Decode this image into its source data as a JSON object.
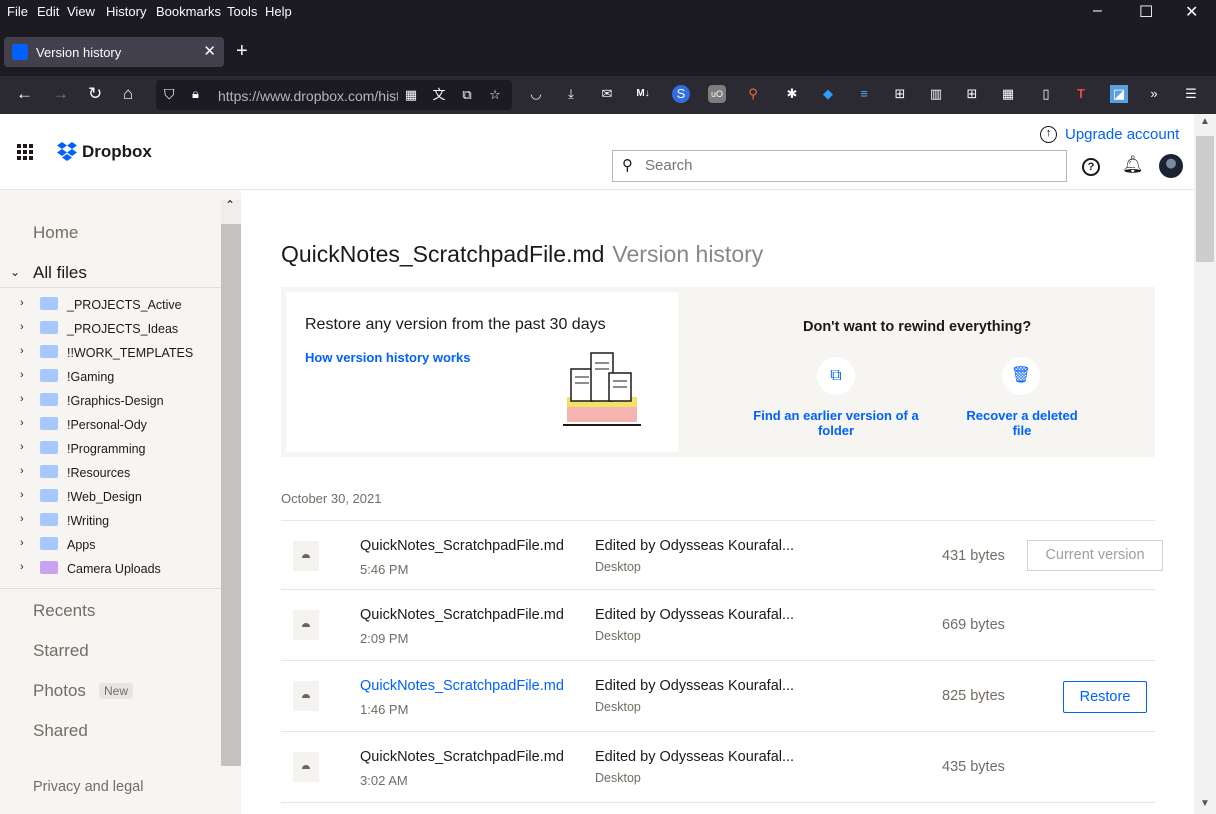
{
  "browser": {
    "menu": [
      "File",
      "Edit",
      "View",
      "History",
      "Bookmarks",
      "Tools",
      "Help"
    ],
    "tab_title": "Version history",
    "url": "https://www.dropbox.com/history"
  },
  "header": {
    "logo": "Dropbox",
    "upgrade": "Upgrade account",
    "search_placeholder": "Search"
  },
  "sidebar": {
    "home": "Home",
    "all_files": "All files",
    "folders": [
      "_PROJECTS_Active",
      "_PROJECTS_Ideas",
      "!!WORK_TEMPLATES",
      "!Gaming",
      "!Graphics-Design",
      "!Personal-Ody",
      "!Programming",
      "!Resources",
      "!Web_Design",
      "!Writing",
      "Apps",
      "Camera Uploads"
    ],
    "recents": "Recents",
    "starred": "Starred",
    "photos": "Photos",
    "photos_badge": "New",
    "shared": "Shared",
    "privacy": "Privacy and legal"
  },
  "main": {
    "filename": "QuickNotes_ScratchpadFile.md",
    "subtitle": "Version history",
    "banner": {
      "heading": "Restore any version from the past 30 days",
      "link": "How version history works",
      "right_heading": "Don't want to rewind everything?",
      "action1": "Find an earlier version of a folder",
      "action2": "Recover a deleted file"
    },
    "date": "October 30, 2021",
    "versions": [
      {
        "name": "QuickNotes_ScratchpadFile.md",
        "time": "5:46 PM",
        "edited": "Edited by Odysseas Kourafal...",
        "device": "Desktop",
        "size": "431 bytes",
        "action": "Current version"
      },
      {
        "name": "QuickNotes_ScratchpadFile.md",
        "time": "2:09 PM",
        "edited": "Edited by Odysseas Kourafal...",
        "device": "Desktop",
        "size": "669 bytes",
        "action": ""
      },
      {
        "name": "QuickNotes_ScratchpadFile.md",
        "time": "1:46 PM",
        "edited": "Edited by Odysseas Kourafal...",
        "device": "Desktop",
        "size": "825 bytes",
        "action": "Restore"
      },
      {
        "name": "QuickNotes_ScratchpadFile.md",
        "time": "3:02 AM",
        "edited": "Edited by Odysseas Kourafal...",
        "device": "Desktop",
        "size": "435 bytes",
        "action": ""
      }
    ]
  }
}
